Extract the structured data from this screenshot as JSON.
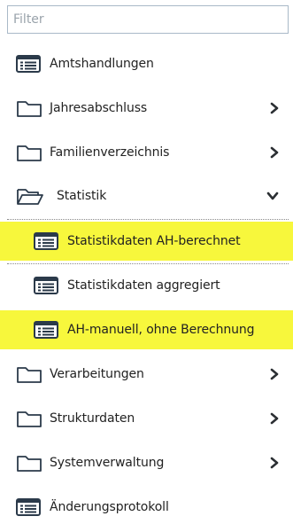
{
  "filter": {
    "placeholder": "Filter",
    "value": ""
  },
  "tree": {
    "items": [
      {
        "label": "Amtshandlungen",
        "icon": "list-icon"
      },
      {
        "label": "Jahresabschluss",
        "icon": "folder-icon",
        "state": "collapsed"
      },
      {
        "label": "Familienverzeichnis",
        "icon": "folder-icon",
        "state": "collapsed"
      },
      {
        "label": "Statistik",
        "icon": "folder-open-icon",
        "state": "expanded"
      },
      {
        "label": "Statistikdaten AH-berechnet",
        "icon": "list-icon",
        "highlighted": true
      },
      {
        "label": "Statistikdaten aggregiert",
        "icon": "list-icon"
      },
      {
        "label": "AH-manuell, ohne Berechnung",
        "icon": "list-icon",
        "highlighted": true
      },
      {
        "label": "Verarbeitungen",
        "icon": "folder-icon",
        "state": "collapsed"
      },
      {
        "label": "Strukturdaten",
        "icon": "folder-icon",
        "state": "collapsed"
      },
      {
        "label": "Systemverwaltung",
        "icon": "folder-icon",
        "state": "collapsed"
      },
      {
        "label": "Änderungsprotokoll",
        "icon": "list-icon"
      }
    ]
  },
  "colors": {
    "highlight": "#f7f73c",
    "icon": "#2b3a4a",
    "chevron": "#2b2f33"
  }
}
